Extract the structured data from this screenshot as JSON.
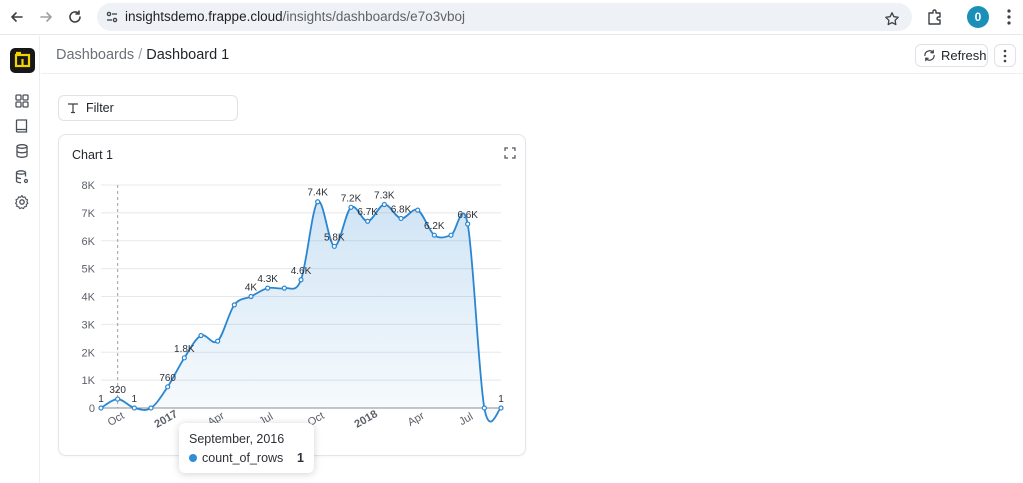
{
  "browser": {
    "url_domain": "insightsdemo.frappe.cloud",
    "url_path": "/insights/dashboards/e7o3vboj",
    "profile_initial": "0"
  },
  "sidebar": {
    "items": [
      {
        "icon": "grid-icon",
        "name": "dashboards"
      },
      {
        "icon": "book-icon",
        "name": "notebooks"
      },
      {
        "icon": "database-icon",
        "name": "data-sources"
      },
      {
        "icon": "database-settings-icon",
        "name": "tables"
      },
      {
        "icon": "gear-icon",
        "name": "settings"
      }
    ]
  },
  "header": {
    "breadcrumb_parent": "Dashboards",
    "breadcrumb_sep": "/",
    "breadcrumb_current": "Dashboard 1",
    "refresh_label": "Refresh"
  },
  "filter": {
    "label": "Filter"
  },
  "chart_card": {
    "title": "Chart 1"
  },
  "tooltip": {
    "title": "September, 2016",
    "series": "count_of_rows",
    "value": "1"
  },
  "colors": {
    "line": "#2a86d1",
    "accent": "#171717",
    "brand_icon": "#f5d100"
  },
  "chart_data": {
    "type": "area",
    "y_ticks": [
      "0",
      "1K",
      "2K",
      "3K",
      "4K",
      "5K",
      "6K",
      "7K",
      "8K"
    ],
    "ylim": [
      0,
      8000
    ],
    "x_tick_labels": [
      {
        "label": "Oct",
        "at": 1,
        "bold": false
      },
      {
        "label": "2017",
        "at": 4,
        "bold": true
      },
      {
        "label": "Apr",
        "at": 7,
        "bold": false
      },
      {
        "label": "Jul",
        "at": 10,
        "bold": false
      },
      {
        "label": "Oct",
        "at": 13,
        "bold": false
      },
      {
        "label": "2018",
        "at": 16,
        "bold": true
      },
      {
        "label": "Apr",
        "at": 19,
        "bold": false
      },
      {
        "label": "Jul",
        "at": 22,
        "bold": false
      }
    ],
    "x": [
      "2016-09",
      "2016-10",
      "2016-11",
      "2016-12",
      "2017-01",
      "2017-02",
      "2017-03",
      "2017-04",
      "2017-05",
      "2017-06",
      "2017-07",
      "2017-08",
      "2017-09",
      "2017-10",
      "2017-11",
      "2017-12",
      "2018-01",
      "2018-02",
      "2018-03",
      "2018-04",
      "2018-05",
      "2018-06",
      "2018-07",
      "2018-08",
      "2018-09"
    ],
    "series": [
      {
        "name": "count_of_rows",
        "values": [
          1,
          320,
          1,
          1,
          760,
          1800,
          2600,
          2400,
          3700,
          4000,
          4300,
          4300,
          4600,
          7400,
          5800,
          7200,
          6700,
          7300,
          6800,
          7100,
          6200,
          6200,
          6600,
          1,
          1
        ],
        "labels": [
          "1",
          "320",
          "1",
          "",
          "760",
          "1.8K",
          "",
          "",
          "",
          "4K",
          "4.3K",
          "",
          "4.6K",
          "7.4K",
          "5.8K",
          "7.2K",
          "6.7K",
          "7.3K",
          "6.8K",
          "",
          "6.2K",
          "",
          "6.6K",
          "",
          "1"
        ]
      }
    ],
    "hover_index": 0,
    "grid": true,
    "legend": "none"
  }
}
